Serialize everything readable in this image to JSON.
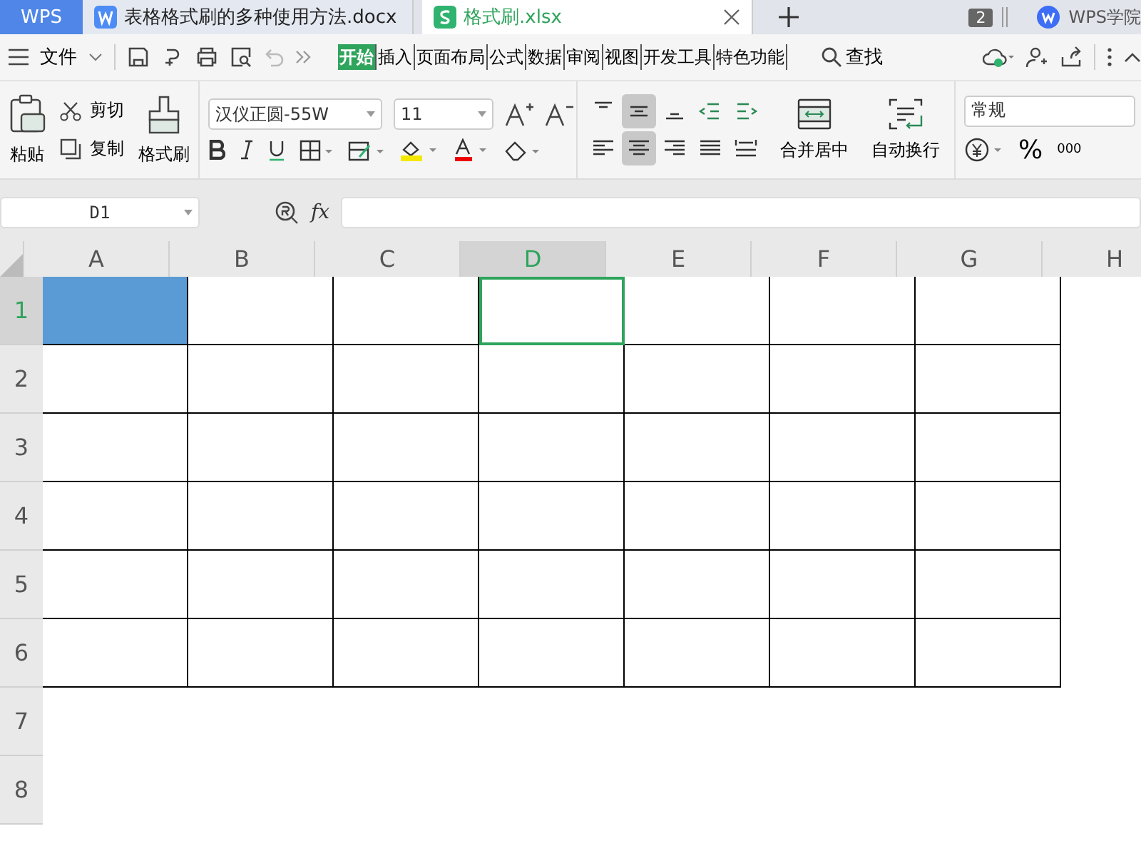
{
  "tabs": [
    {
      "label": "WPS",
      "kind": "home"
    },
    {
      "label": "表格格式刷的多种使用方法.docx",
      "kind": "doc",
      "selected": false
    },
    {
      "label": "格式刷.xlsx",
      "kind": "sheet",
      "selected": true
    }
  ],
  "window_count": "2",
  "account": "WPS学院",
  "menu": {
    "file": "文件",
    "tabs": [
      {
        "label": "开始",
        "selected": true
      },
      {
        "label": "插入",
        "selected": false
      },
      {
        "label": "页面布局",
        "selected": false
      },
      {
        "label": "公式",
        "selected": false
      },
      {
        "label": "数据",
        "selected": false
      },
      {
        "label": "审阅",
        "selected": false
      },
      {
        "label": "视图",
        "selected": false
      },
      {
        "label": "开发工具",
        "selected": false
      },
      {
        "label": "特色功能",
        "selected": false
      }
    ],
    "search": "查找"
  },
  "clipboard": {
    "paste": "粘贴",
    "cut": "剪切",
    "copy": "复制",
    "format_painter": "格式刷"
  },
  "font": {
    "name": "汉仪正圆-55W",
    "size": "11"
  },
  "alignment": {
    "vertical": [
      {
        "kind": "top",
        "selected": false
      },
      {
        "kind": "middle",
        "selected": true
      },
      {
        "kind": "bottom",
        "selected": false
      },
      {
        "kind": "outdent",
        "selected": false
      },
      {
        "kind": "indent",
        "selected": false
      }
    ],
    "horizontal": [
      {
        "kind": "left",
        "selected": false
      },
      {
        "kind": "center",
        "selected": true
      },
      {
        "kind": "right",
        "selected": false
      },
      {
        "kind": "justify",
        "selected": false
      },
      {
        "kind": "distributed",
        "selected": false
      }
    ],
    "merge": "合并居中",
    "wrap": "自动换行"
  },
  "number": {
    "format": "常规",
    "percent": "%",
    "thousands": "000"
  },
  "formula_bar": {
    "name_box": "D1",
    "fx": "fx"
  },
  "columns": [
    {
      "label": "A",
      "selected": false
    },
    {
      "label": "B",
      "selected": false
    },
    {
      "label": "C",
      "selected": false
    },
    {
      "label": "D",
      "selected": true
    },
    {
      "label": "E",
      "selected": false
    },
    {
      "label": "F",
      "selected": false
    },
    {
      "label": "G",
      "selected": false
    },
    {
      "label": "H",
      "selected": false
    }
  ],
  "rows": [
    {
      "label": "1",
      "selected": true,
      "cells": [
        {
          "filled": true,
          "active": false
        },
        {
          "filled": false,
          "active": false
        },
        {
          "filled": false,
          "active": false
        },
        {
          "filled": false,
          "active": true
        },
        {
          "filled": false,
          "active": false
        },
        {
          "filled": false,
          "active": false
        },
        {
          "filled": false,
          "active": false
        }
      ]
    },
    {
      "label": "2",
      "selected": false,
      "cells": [
        {
          "filled": false,
          "active": false
        },
        {
          "filled": false,
          "active": false
        },
        {
          "filled": false,
          "active": false
        },
        {
          "filled": false,
          "active": false
        },
        {
          "filled": false,
          "active": false
        },
        {
          "filled": false,
          "active": false
        },
        {
          "filled": false,
          "active": false
        }
      ]
    },
    {
      "label": "3",
      "selected": false,
      "cells": [
        {
          "filled": false,
          "active": false
        },
        {
          "filled": false,
          "active": false
        },
        {
          "filled": false,
          "active": false
        },
        {
          "filled": false,
          "active": false
        },
        {
          "filled": false,
          "active": false
        },
        {
          "filled": false,
          "active": false
        },
        {
          "filled": false,
          "active": false
        }
      ]
    },
    {
      "label": "4",
      "selected": false,
      "cells": [
        {
          "filled": false,
          "active": false
        },
        {
          "filled": false,
          "active": false
        },
        {
          "filled": false,
          "active": false
        },
        {
          "filled": false,
          "active": false
        },
        {
          "filled": false,
          "active": false
        },
        {
          "filled": false,
          "active": false
        },
        {
          "filled": false,
          "active": false
        }
      ]
    },
    {
      "label": "5",
      "selected": false,
      "cells": [
        {
          "filled": false,
          "active": false
        },
        {
          "filled": false,
          "active": false
        },
        {
          "filled": false,
          "active": false
        },
        {
          "filled": false,
          "active": false
        },
        {
          "filled": false,
          "active": false
        },
        {
          "filled": false,
          "active": false
        },
        {
          "filled": false,
          "active": false
        }
      ]
    },
    {
      "label": "6",
      "selected": false,
      "cells": [
        {
          "filled": false,
          "active": false
        },
        {
          "filled": false,
          "active": false
        },
        {
          "filled": false,
          "active": false
        },
        {
          "filled": false,
          "active": false
        },
        {
          "filled": false,
          "active": false
        },
        {
          "filled": false,
          "active": false
        },
        {
          "filled": false,
          "active": false
        }
      ]
    },
    {
      "label": "7",
      "selected": false,
      "cells": []
    },
    {
      "label": "8",
      "selected": false,
      "cells": []
    }
  ]
}
